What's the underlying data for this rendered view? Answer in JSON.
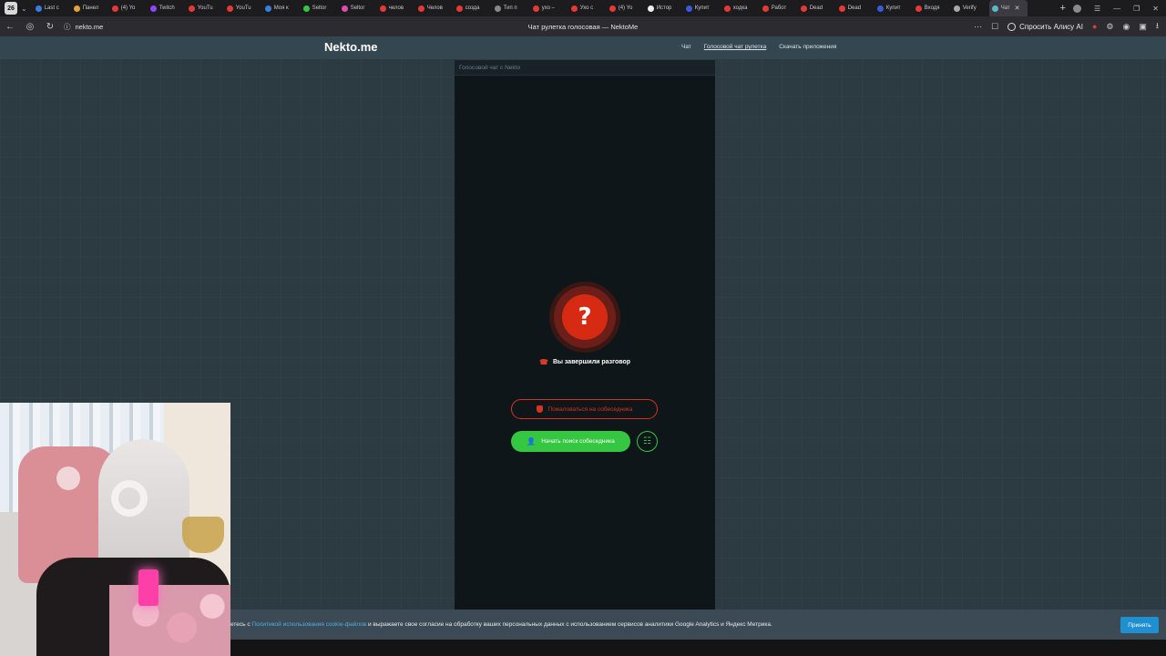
{
  "browser": {
    "tab_count": "26",
    "tabs": [
      {
        "label": "Last c",
        "color": "#3b7ddd"
      },
      {
        "label": "Панел",
        "color": "#e8a23a"
      },
      {
        "label": "(4) Yo",
        "color": "#e53935"
      },
      {
        "label": "Twitch",
        "color": "#9146ff"
      },
      {
        "label": "YouTu",
        "color": "#e53935"
      },
      {
        "label": "YouTu",
        "color": "#e53935"
      },
      {
        "label": "Моя к",
        "color": "#3b7ddd"
      },
      {
        "label": "Seltor",
        "color": "#35c642"
      },
      {
        "label": "Seltor",
        "color": "#e04bb0"
      },
      {
        "label": "челов",
        "color": "#e53935"
      },
      {
        "label": "Челов",
        "color": "#e53935"
      },
      {
        "label": "созда",
        "color": "#e53935"
      },
      {
        "label": "Тип п",
        "color": "#888888"
      },
      {
        "label": "ухо –",
        "color": "#e53935"
      },
      {
        "label": "Ухо с",
        "color": "#e53935"
      },
      {
        "label": "(4) Yo",
        "color": "#e53935"
      },
      {
        "label": "Истор",
        "color": "#eeeeee"
      },
      {
        "label": "Купит",
        "color": "#3b5bdb"
      },
      {
        "label": "ходка",
        "color": "#e53935"
      },
      {
        "label": "Работ",
        "color": "#e53935"
      },
      {
        "label": "Dead",
        "color": "#e53935"
      },
      {
        "label": "Dead",
        "color": "#e53935"
      },
      {
        "label": "Купит",
        "color": "#3b5bdb"
      },
      {
        "label": "Входя",
        "color": "#e53935"
      },
      {
        "label": "Verify",
        "color": "#aaaaaa"
      },
      {
        "label": "Чат",
        "color": "#5ab8c9",
        "active": true
      }
    ],
    "url": "nekto.me",
    "page_title": "Чат рулетка голосовая — NektoMe",
    "alice_label": "Спросить Алису AI"
  },
  "site": {
    "logo": "Nekto.me",
    "nav": [
      "Чат",
      "Голосовой чат рулетка",
      "Скачать приложения"
    ]
  },
  "chat": {
    "header": "Голосовой чат с Nekto",
    "status_symbol": "?",
    "end_message": "Вы завершили разговор",
    "report_label": "Пожаловаться на собеседника",
    "search_label": "Начать поиск собеседника"
  },
  "cookie": {
    "text_before": "етесь с ",
    "link": "Политикой использования cookie-файлов",
    "text_after": " и выражаете свое согласие на обработку ваших персональных данных с использованием сервисов аналитики Google Analytics и Яндекс Метрика.",
    "accept_label": "Принять"
  },
  "colors": {
    "accent_green": "#35c642",
    "alert_red": "#d7331f",
    "link_blue": "#4fb0e6"
  }
}
